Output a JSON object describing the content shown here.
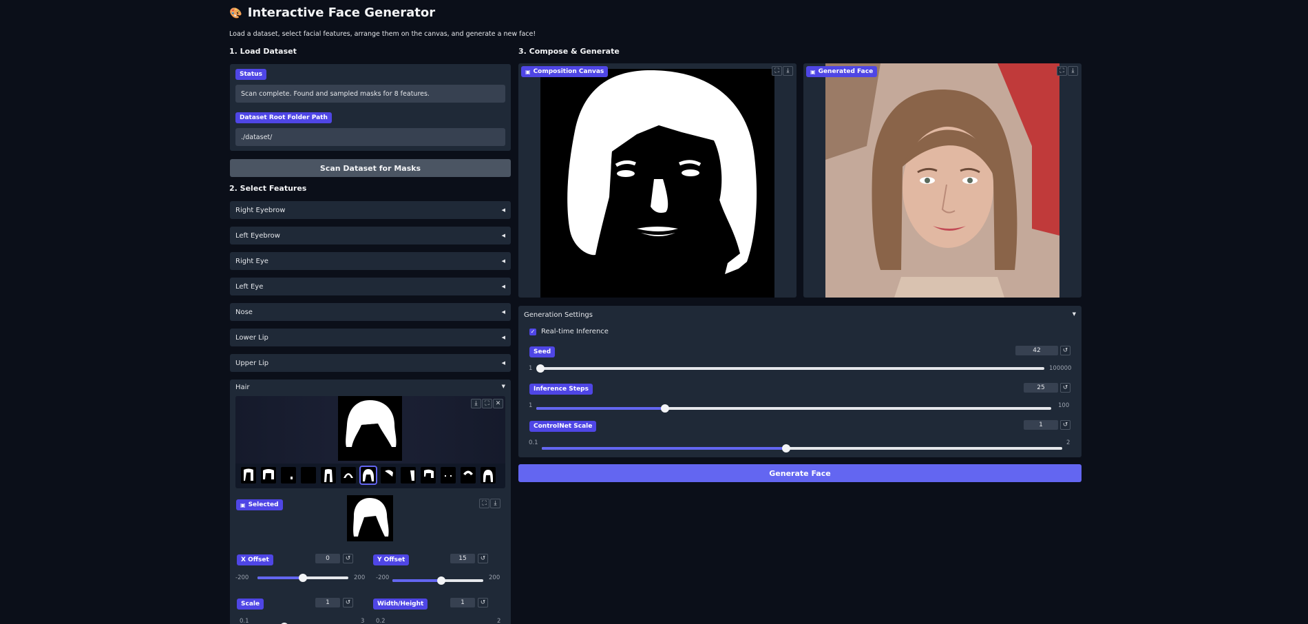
{
  "header": {
    "title": "Interactive Face Generator",
    "emoji": "🎨",
    "subtitle": "Load a dataset, select facial features, arrange them on the canvas, and generate a new face!"
  },
  "load_dataset": {
    "heading": "1. Load Dataset",
    "status_label": "Status",
    "status_value": "Scan complete. Found and sampled masks for 8 features.",
    "path_label": "Dataset Root Folder Path",
    "path_value": "./dataset/",
    "scan_button": "Scan Dataset for Masks"
  },
  "select_features": {
    "heading": "2. Select Features",
    "items": [
      "Right Eyebrow",
      "Left Eyebrow",
      "Right Eye",
      "Left Eye",
      "Nose",
      "Lower Lip",
      "Upper Lip",
      "Hair"
    ],
    "selected_label": "Selected",
    "x_offset": {
      "label": "X Offset",
      "value": "0",
      "min": "-200",
      "max": "200",
      "fraction": 0.5
    },
    "y_offset": {
      "label": "Y Offset",
      "value": "15",
      "min": "-200",
      "max": "200",
      "fraction": 0.54
    },
    "scale": {
      "label": "Scale",
      "value": "1",
      "min": "0.1",
      "max": "3",
      "fraction": 0.31
    },
    "width_height": {
      "label": "Width/Height",
      "value": "1",
      "min": "0.2",
      "max": "2",
      "fraction": 0.44
    }
  },
  "compose": {
    "heading": "3. Compose & Generate",
    "canvas_label": "Composition Canvas",
    "generated_label": "Generated Face",
    "settings_label": "Generation Settings",
    "realtime_label": "Real-time Inference",
    "realtime_checked": true,
    "seed": {
      "label": "Seed",
      "value": "42",
      "min": "1",
      "max": "100000",
      "fraction": 0.0
    },
    "steps": {
      "label": "Inference Steps",
      "value": "25",
      "min": "1",
      "max": "100",
      "fraction": 0.25
    },
    "controlnet": {
      "label": "ControlNet Scale",
      "value": "1",
      "min": "0.1",
      "max": "2",
      "fraction": 0.47
    },
    "generate_button": "Generate Face"
  },
  "icons": {
    "image": "image-icon",
    "fullscreen": "fullscreen-icon",
    "download": "download-icon",
    "reset": "reset-icon",
    "close": "close-icon"
  },
  "colors": {
    "accent": "#4f46e5",
    "primary_button": "#6366f1",
    "background": "#0b0f19",
    "panel": "#1f2937"
  }
}
